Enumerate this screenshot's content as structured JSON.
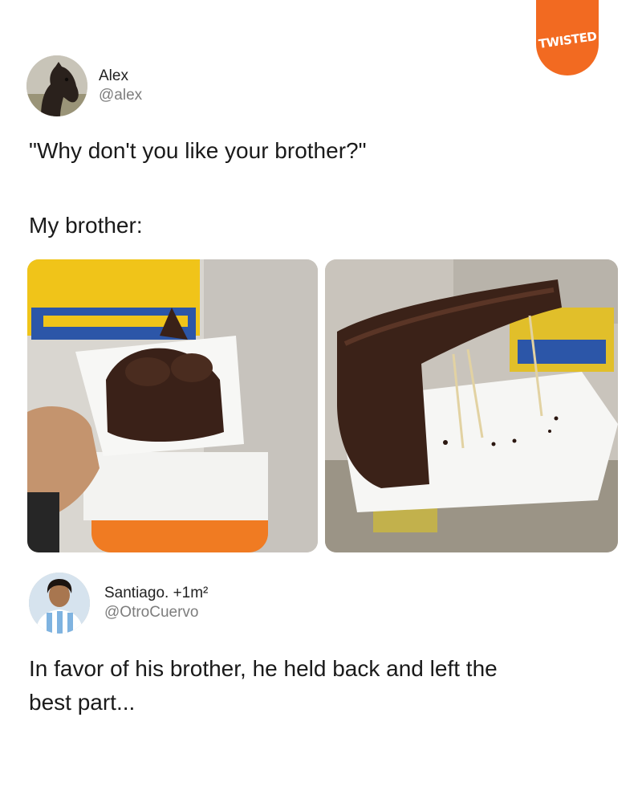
{
  "brand": {
    "badge_text": "TWISTED",
    "color": "#f26a21"
  },
  "post": {
    "author_name": "Alex",
    "author_handle": "@alex",
    "line1": "\"Why don't you like your brother?\"",
    "line2": "My brother:",
    "avatar_icon": "horse-avatar"
  },
  "images": [
    {
      "icon": "whole-chocolate-cake-slice-photo"
    },
    {
      "icon": "hollowed-chocolate-cake-slice-photo"
    }
  ],
  "reply": {
    "author_name": "Santiago. +1m²",
    "author_handle": "@OtroCuervo",
    "text_line1": "In favor of his brother, he held back and left the",
    "text_line2": "best part...",
    "avatar_icon": "footballer-avatar"
  }
}
